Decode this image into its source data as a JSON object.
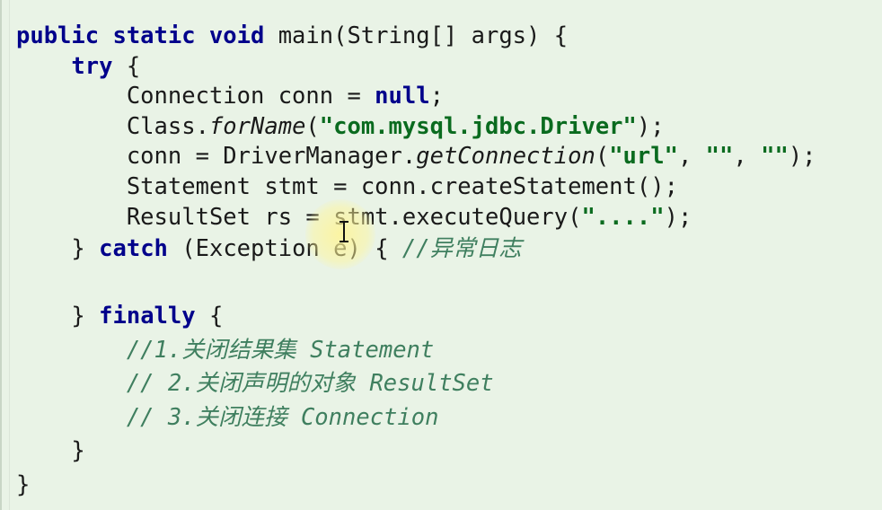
{
  "code": {
    "lines": [
      {
        "indent": "",
        "t1": "public static void",
        "t2": " main(String[] args) {"
      },
      {
        "indent": "    ",
        "t1": "try",
        "t2": " {"
      },
      {
        "indent": "        ",
        "t1": "Connection conn = ",
        "t2": "null",
        "t3": ";"
      },
      {
        "indent": "        ",
        "t1": "Class.",
        "t2": "forName",
        "t3": "(",
        "t4": "\"com.mysql.jdbc.Driver\"",
        "t5": ");"
      },
      {
        "indent": "        ",
        "t1": "conn = DriverManager.",
        "t2": "getConnection",
        "t3": "(",
        "t4": "\"url\"",
        "t5": ", ",
        "t6": "\"\"",
        "t7": ", ",
        "t8": "\"\"",
        "t9": ");"
      },
      {
        "indent": "        ",
        "t1": "Statement stmt = conn.createStatement();"
      },
      {
        "indent": "        ",
        "t1": "ResultSet rs = stmt.executeQuery(",
        "t2": "\"....\"",
        "t3": ");"
      },
      {
        "indent": "    ",
        "t1": "} ",
        "t2": "catch",
        "t3": " (Exception e) { ",
        "t4": "//异常日志"
      },
      {
        "indent": "",
        "t1": ""
      },
      {
        "indent": "    ",
        "t1": "} ",
        "t2": "finally",
        "t3": " {"
      },
      {
        "indent": "        ",
        "t1": "//1.关闭结果集 Statement"
      },
      {
        "indent": "        ",
        "t1": "// 2.关闭声明的对象 ResultSet"
      },
      {
        "indent": "        ",
        "t1": "// 3.关闭连接 Connection"
      },
      {
        "indent": "    ",
        "t1": "}"
      },
      {
        "indent": "",
        "t1": "}"
      }
    ]
  },
  "colors": {
    "background": "#e9f3e6",
    "keyword": "#00008b",
    "string": "#0a6b1f",
    "comment": "#3f7f5f",
    "cursor_highlight": "#fff596"
  },
  "icons": {
    "cursor": "text-cursor-icon"
  }
}
